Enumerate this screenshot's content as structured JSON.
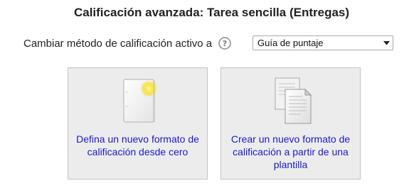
{
  "header": {
    "title": "Calificación avanzada: Tarea sencilla (Entregas)"
  },
  "method": {
    "label": "Cambiar método de calificación activo a",
    "help_icon": "question-circle-icon",
    "selected": "Guía de puntaje"
  },
  "options": [
    {
      "label": "Defina un nuevo formato de calificación desde cero",
      "icon": "blank-document-icon"
    },
    {
      "label": "Crear un nuevo formato de calificación a partir de una plantilla",
      "icon": "copy-documents-icon"
    }
  ],
  "colors": {
    "link": "#1a1acc",
    "card_background": "#ececec",
    "card_border": "#c3c3c3",
    "accent_glow": "#f5d800"
  }
}
